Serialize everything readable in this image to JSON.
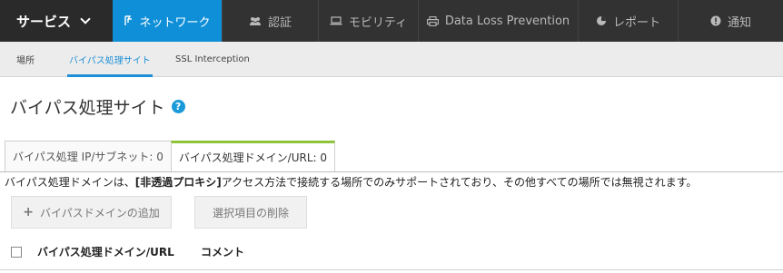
{
  "topnav": {
    "service_label": "サービス",
    "items": [
      {
        "label": "ネットワーク",
        "icon": "network-icon"
      },
      {
        "label": "認証",
        "icon": "users-icon"
      },
      {
        "label": "モビリティ",
        "icon": "laptop-icon"
      },
      {
        "label": "Data Loss Prevention",
        "icon": "printer-icon"
      },
      {
        "label": "レポート",
        "icon": "pie-chart-icon"
      },
      {
        "label": "通知",
        "icon": "alert-icon"
      }
    ],
    "active_color": "#0f8fd8"
  },
  "subnav": {
    "tabs": [
      {
        "label": "場所"
      },
      {
        "label": "バイパス処理サイト"
      },
      {
        "label": "SSL Interception"
      }
    ]
  },
  "page": {
    "title": "バイパス処理サイト",
    "help": "?"
  },
  "panel_tabs": [
    {
      "label": "バイパス処理 IP/サブネット: 0"
    },
    {
      "label": "バイパス処理ドメイン/URL: 0"
    }
  ],
  "note": {
    "prefix": "バイパス処理ドメインは、",
    "bold": "[非透過プロキシ]",
    "suffix": "アクセス方法で接続する場所でのみサポートされており、その他すべての場所では無視されます。"
  },
  "buttons": {
    "add": "バイパスドメインの追加",
    "add_icon": "+",
    "delete": "選択項目の削除"
  },
  "table": {
    "columns": [
      "バイパス処理ドメイン/URL",
      "コメント"
    ]
  }
}
